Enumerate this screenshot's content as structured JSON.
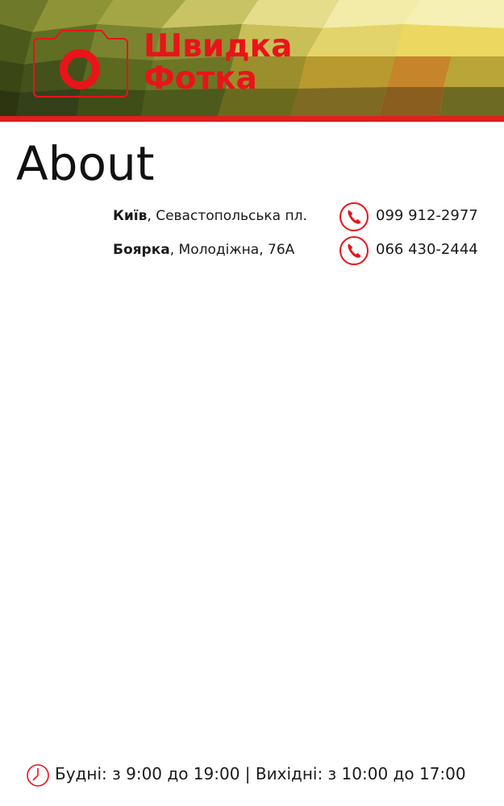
{
  "header": {
    "logo_line1": "Швидка",
    "logo_line2": "Фотка",
    "logo_icon": "camera-icon",
    "brand_red": "#e8141a"
  },
  "page": {
    "title": "About"
  },
  "contacts": [
    {
      "city": "Київ",
      "address": ", Севастопольська пл.",
      "phone": "099 912-2977",
      "icon": "phone-icon"
    },
    {
      "city": "Боярка",
      "address": ", Молодіжна, 76А",
      "phone": "066 430-2444",
      "icon": "phone-icon"
    }
  ],
  "footer": {
    "icon": "clock-icon",
    "hours": "Будні: з 9:00 до 19:00 | Вихідні: з 10:00 до 17:00"
  }
}
